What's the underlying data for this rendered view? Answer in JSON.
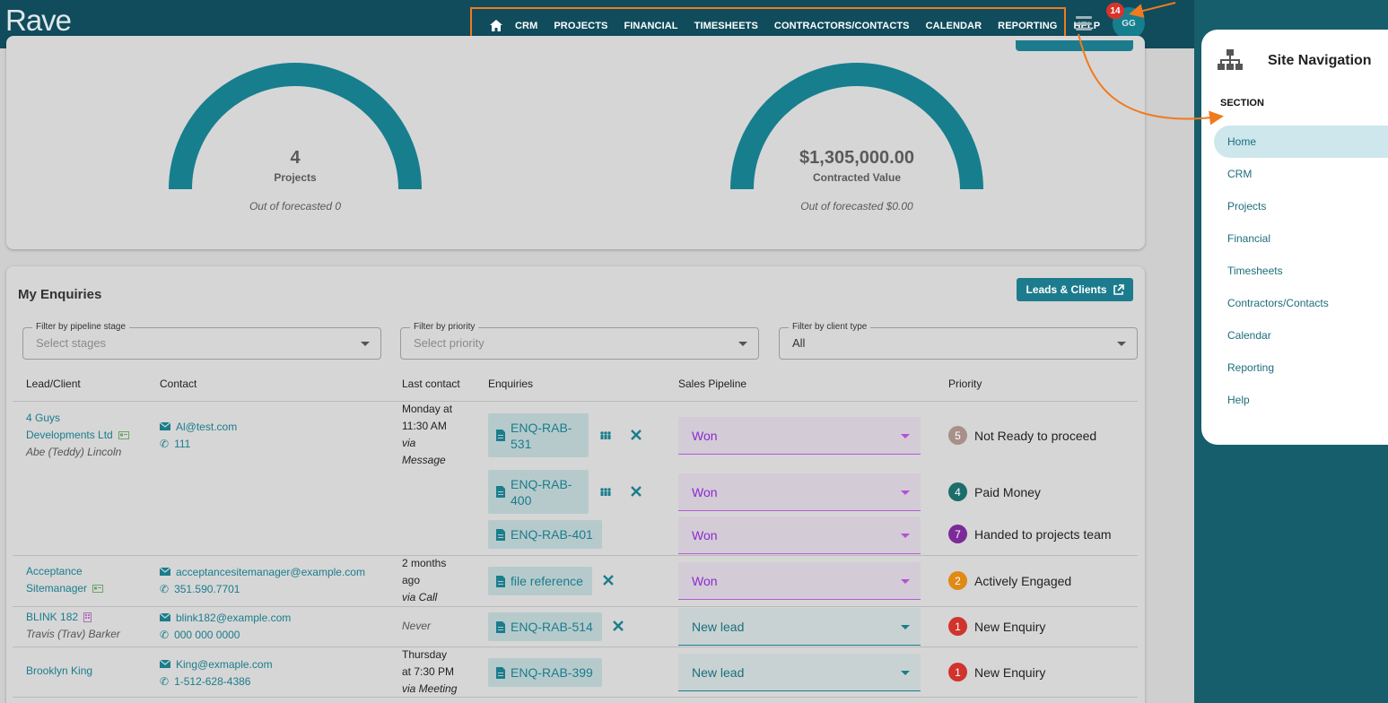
{
  "app": {
    "logo": "Rave"
  },
  "nav": {
    "items": [
      "CRM",
      "PROJECTS",
      "FINANCIAL",
      "TIMESHEETS",
      "CONTRACTORS/CONTACTS",
      "CALENDAR",
      "REPORTING",
      "HELP"
    ]
  },
  "user": {
    "initials": "GG",
    "notifications": "14"
  },
  "stats": {
    "projects": {
      "value": "4",
      "label": "Projects",
      "sub": "Out of forecasted 0"
    },
    "contracted": {
      "value": "$1,305,000.00",
      "label": "Contracted Value",
      "sub": "Out of forecasted $0.00"
    }
  },
  "enquiries": {
    "title": "My Enquiries",
    "leads_button": "Leads & Clients",
    "filters": {
      "stage": {
        "label": "Filter by pipeline stage",
        "placeholder": "Select stages"
      },
      "priority": {
        "label": "Filter by priority",
        "placeholder": "Select priority"
      },
      "client_type": {
        "label": "Filter by client type",
        "value": "All"
      }
    },
    "columns": [
      "Lead/Client",
      "Contact",
      "Last contact",
      "Enquiries",
      "Sales Pipeline",
      "Priority"
    ],
    "rows": [
      {
        "client_line1": "4 Guys",
        "client_line2": "Developments Ltd",
        "person": "Abe (Teddy) Lincoln",
        "email": "Al@test.com",
        "phone": "111",
        "last_line1": "Monday at",
        "last_line2": "11:30 AM",
        "via1": "via",
        "via2": "Message",
        "enquiries": [
          {
            "ref1": "ENQ-RAB-",
            "ref2": "531",
            "stage": "Won",
            "prio_num": "5",
            "prio": "Not Ready to proceed"
          },
          {
            "ref1": "ENQ-RAB-",
            "ref2": "400",
            "stage": "Won",
            "prio_num": "4",
            "prio": "Paid Money"
          },
          {
            "ref": "ENQ-RAB-401",
            "stage": "Won",
            "prio_num": "7",
            "prio": "Handed to projects team"
          }
        ]
      },
      {
        "client_line1": "Acceptance",
        "client_line2": "Sitemanager",
        "email": "acceptancesitemanager@example.com",
        "phone": "351.590.7701",
        "last_line1": "2 months",
        "last_line2": "ago",
        "via": "via Call",
        "enq_ref": "file reference",
        "stage": "Won",
        "prio_num": "2",
        "prio": "Actively Engaged"
      },
      {
        "client": "BLINK 182",
        "person": "Travis (Trav) Barker",
        "email": "blink182@example.com",
        "phone": "000 000 0000",
        "last": "Never",
        "enq_ref": "ENQ-RAB-514",
        "stage": "New lead",
        "prio_num": "1",
        "prio": "New Enquiry"
      },
      {
        "client": "Brooklyn King",
        "email": "King@exmaple.com",
        "phone": "1-512-628-4386",
        "last_line1": "Thursday",
        "last_line2": "at 7:30 PM",
        "via": "via Meeting",
        "enq_ref": "ENQ-RAB-399",
        "stage": "New lead",
        "prio_num": "1",
        "prio": "New Enquiry"
      }
    ]
  },
  "site_nav": {
    "title": "Site Navigation",
    "section": "SECTION",
    "items": [
      "Home",
      "CRM",
      "Projects",
      "Financial",
      "Timesheets",
      "Contractors/Contacts",
      "Calendar",
      "Reporting",
      "Help"
    ]
  },
  "colors": {
    "topbar": "#104c5c",
    "accent": "#1c7c8d",
    "annotation": "#f07a1e",
    "won": "#8b2ad0",
    "prio_5": "#a8908a",
    "prio_4": "#1b6e6a",
    "prio_7": "#7b2a98",
    "prio_2": "#e08a16",
    "prio_1": "#d0342c"
  }
}
